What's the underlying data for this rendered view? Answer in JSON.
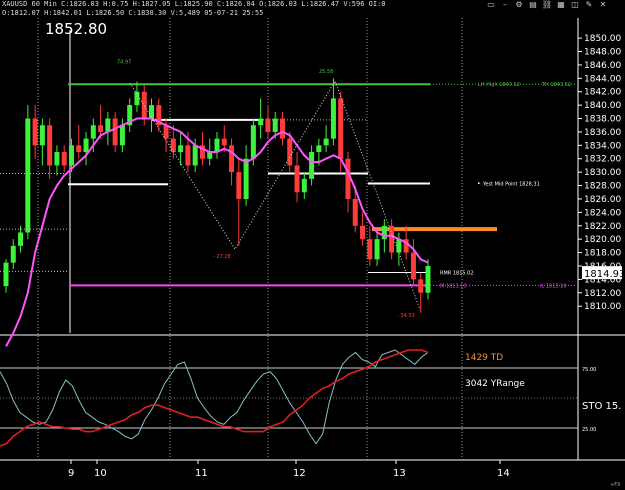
{
  "header": {
    "line1": "XAUUSD 60 Min  C:1826.03  H:0.75  H:1827.05  L:1825.90  C:1826.04  O:1826.03  L:1826.47  V:596  OI:0",
    "line2": "O:1812.07  H:1842.01  L:1826.50  C:1838.30  V:5,489  05-07-21  25:55"
  },
  "top_icons": [
    "restore-icon",
    "minimize-icon",
    "settings-icon",
    "chart-icon",
    "link-icon",
    "grid-icon",
    "window-icon",
    "settings-icon",
    "close-icon"
  ],
  "last_price_big": "1852.80",
  "chart_data": [
    {
      "type": "candlestick",
      "title": "XAUUSD 60 Min",
      "x_tick_labels": [
        "9",
        "10",
        "11",
        "12",
        "13",
        "14"
      ],
      "ylim": [
        1806,
        1853
      ],
      "y_tick_labels": [
        "1850.00",
        "1848.00",
        "1846.00",
        "1844.00",
        "1842.00",
        "1840.00",
        "1838.00",
        "1836.00",
        "1834.00",
        "1832.00",
        "1830.00",
        "1828.00",
        "1826.00",
        "1824.00",
        "1822.00",
        "1820.00",
        "1818.00",
        "1816.00",
        "1814.00",
        "1812.00",
        "1810.00"
      ],
      "current_price": "1814.93",
      "candles": [
        [
          1813.0,
          1817.0,
          1812.0,
          1816.5
        ],
        [
          1816.5,
          1820.0,
          1815.5,
          1819.0
        ],
        [
          1819.0,
          1822.0,
          1818.0,
          1821.0
        ],
        [
          1821.0,
          1840.0,
          1820.0,
          1838.0
        ],
        [
          1838.0,
          1840.0,
          1832.0,
          1834.0
        ],
        [
          1834.0,
          1838.0,
          1831.0,
          1837.0
        ],
        [
          1837.0,
          1838.0,
          1829.0,
          1831.0
        ],
        [
          1831.0,
          1834.0,
          1829.5,
          1833.0
        ],
        [
          1833.0,
          1834.0,
          1830.0,
          1831.0
        ],
        [
          1831.0,
          1835.0,
          1830.0,
          1834.0
        ],
        [
          1834.0,
          1837.0,
          1832.0,
          1833.0
        ],
        [
          1833.0,
          1836.0,
          1831.0,
          1835.0
        ],
        [
          1835.0,
          1838.0,
          1833.0,
          1837.0
        ],
        [
          1837.0,
          1840.0,
          1835.0,
          1836.0
        ],
        [
          1836.0,
          1839.0,
          1834.0,
          1838.0
        ],
        [
          1838.0,
          1839.0,
          1833.0,
          1834.0
        ],
        [
          1834.0,
          1838.0,
          1833.0,
          1837.0
        ],
        [
          1837.0,
          1841.0,
          1836.0,
          1840.0
        ],
        [
          1840.0,
          1843.5,
          1839.0,
          1842.0
        ],
        [
          1842.0,
          1843.0,
          1837.0,
          1838.0
        ],
        [
          1838.0,
          1841.0,
          1836.0,
          1840.0
        ],
        [
          1840.0,
          1841.0,
          1836.0,
          1837.0
        ],
        [
          1837.0,
          1838.0,
          1833.0,
          1835.0
        ],
        [
          1835.0,
          1837.0,
          1832.0,
          1833.0
        ],
        [
          1833.0,
          1836.0,
          1831.0,
          1834.0
        ],
        [
          1834.0,
          1836.0,
          1830.0,
          1831.0
        ],
        [
          1831.0,
          1835.0,
          1830.0,
          1834.0
        ],
        [
          1834.0,
          1836.0,
          1831.0,
          1832.0
        ],
        [
          1832.0,
          1835.0,
          1831.0,
          1833.0
        ],
        [
          1833.0,
          1836.0,
          1832.0,
          1835.0
        ],
        [
          1835.0,
          1837.0,
          1833.0,
          1834.0
        ],
        [
          1834.0,
          1835.0,
          1828.0,
          1830.0
        ],
        [
          1830.0,
          1832.0,
          1819.0,
          1826.0
        ],
        [
          1826.0,
          1834.0,
          1825.0,
          1832.0
        ],
        [
          1832.0,
          1838.0,
          1831.0,
          1837.0
        ],
        [
          1837.0,
          1841.0,
          1835.0,
          1838.0
        ],
        [
          1838.0,
          1840.0,
          1835.0,
          1836.0
        ],
        [
          1836.0,
          1839.0,
          1835.0,
          1838.0
        ],
        [
          1838.0,
          1839.0,
          1834.0,
          1835.0
        ],
        [
          1835.0,
          1836.0,
          1830.0,
          1831.0
        ],
        [
          1831.0,
          1833.0,
          1825.5,
          1827.0
        ],
        [
          1827.0,
          1830.0,
          1826.0,
          1829.0
        ],
        [
          1829.0,
          1834.0,
          1828.0,
          1833.0
        ],
        [
          1833.0,
          1835.0,
          1831.0,
          1834.0
        ],
        [
          1834.0,
          1837.0,
          1833.0,
          1835.0
        ],
        [
          1835.0,
          1844.0,
          1834.0,
          1841.0
        ],
        [
          1841.0,
          1842.0,
          1830.0,
          1832.0
        ],
        [
          1832.0,
          1833.0,
          1824.0,
          1826.0
        ],
        [
          1826.0,
          1828.0,
          1821.0,
          1822.0
        ],
        [
          1822.0,
          1824.0,
          1819.0,
          1820.0
        ],
        [
          1820.0,
          1822.0,
          1816.0,
          1817.0
        ],
        [
          1817.0,
          1821.0,
          1816.0,
          1820.0
        ],
        [
          1820.0,
          1823.0,
          1818.0,
          1822.0
        ],
        [
          1822.0,
          1823.0,
          1817.0,
          1818.0
        ],
        [
          1818.0,
          1821.0,
          1816.0,
          1820.0
        ],
        [
          1820.0,
          1822.0,
          1817.0,
          1818.0
        ],
        [
          1818.0,
          1820.0,
          1813.0,
          1814.0
        ],
        [
          1814.0,
          1815.0,
          1809.0,
          1812.0
        ],
        [
          1812.0,
          1817.0,
          1811.0,
          1816.0
        ]
      ],
      "moving_average": [
        1804.0,
        1806.0,
        1808.5,
        1812.0,
        1818.0,
        1822.0,
        1826.0,
        1828.0,
        1829.5,
        1830.5,
        1831.5,
        1832.5,
        1834.0,
        1835.5,
        1836.0,
        1836.5,
        1837.0,
        1837.5,
        1838.0,
        1838.0,
        1838.0,
        1837.5,
        1837.0,
        1836.5,
        1836.0,
        1835.0,
        1834.0,
        1833.5,
        1833.0,
        1833.0,
        1833.5,
        1833.0,
        1832.0,
        1831.5,
        1832.0,
        1833.0,
        1834.5,
        1835.5,
        1836.0,
        1835.5,
        1834.0,
        1832.5,
        1831.5,
        1831.5,
        1832.0,
        1832.5,
        1832.0,
        1830.0,
        1827.5,
        1824.5,
        1822.5,
        1821.0,
        1820.5,
        1820.5,
        1820.0,
        1819.5,
        1818.5,
        1817.0,
        1816.5
      ],
      "annotations": {
        "top_left_label": "74.97",
        "top_mid_label": "25.58",
        "low1_label": "- 27.28",
        "low2_label": "- 34.33",
        "lh_high_label": "LH High 1843.12",
        "th_label": "TH 1843.52",
        "mid_point_label": "Yest Mid Point 1828.31",
        "rmr_label": "RMR 1815.02",
        "m_label": "M 1813.10",
        "il_label": "IL 1813.10"
      },
      "levels": {
        "lh_high": 1843.12,
        "yest_mid": 1828.31,
        "rmr": 1815.02,
        "m": 1813.1,
        "orange_zone": 1821.5
      },
      "level_colors": {
        "lh_high": "#44c43a",
        "white_lines": "#ffffff",
        "rmr": "#ffffff",
        "m": "#ff44ff",
        "orange": "#ff8a2a",
        "ma": "#ff55ff",
        "up_candle": "#3cf23c",
        "down_candle": "#ff3b3b"
      }
    },
    {
      "type": "line",
      "title": "",
      "ylim": [
        0,
        100
      ],
      "y_tick_labels": [
        "25.00",
        "75.00"
      ],
      "series": [
        {
          "name": "",
          "color": "#88c0c8",
          "values": [
            72,
            62,
            48,
            38,
            34,
            30,
            28,
            30,
            40,
            55,
            65,
            60,
            48,
            38,
            34,
            30,
            28,
            25,
            22,
            18,
            16,
            20,
            32,
            40,
            50,
            62,
            70,
            78,
            80,
            66,
            50,
            42,
            35,
            30,
            28,
            34,
            38,
            48,
            56,
            64,
            70,
            72,
            66,
            56,
            46,
            38,
            30,
            20,
            12,
            20,
            46,
            65,
            78,
            84,
            88,
            82,
            80,
            76,
            86,
            88,
            90,
            86,
            82,
            78,
            84,
            88
          ]
        },
        {
          "name": "",
          "color": "#e02020",
          "values": [
            10,
            12,
            18,
            22,
            26,
            28,
            30,
            28,
            26,
            26,
            25,
            24,
            24,
            22,
            22,
            24,
            26,
            28,
            30,
            32,
            36,
            38,
            42,
            44,
            44,
            42,
            40,
            38,
            36,
            34,
            34,
            32,
            30,
            28,
            26,
            26,
            24,
            22,
            22,
            22,
            22,
            26,
            28,
            30,
            36,
            40,
            44,
            50,
            54,
            58,
            60,
            64,
            66,
            70,
            72,
            74,
            76,
            80,
            82,
            84,
            86,
            88,
            90,
            90,
            90,
            88
          ]
        }
      ],
      "labels": {
        "td": "1429 TD",
        "yrange": "3042 YRange",
        "sto": "STO  15."
      }
    }
  ]
}
